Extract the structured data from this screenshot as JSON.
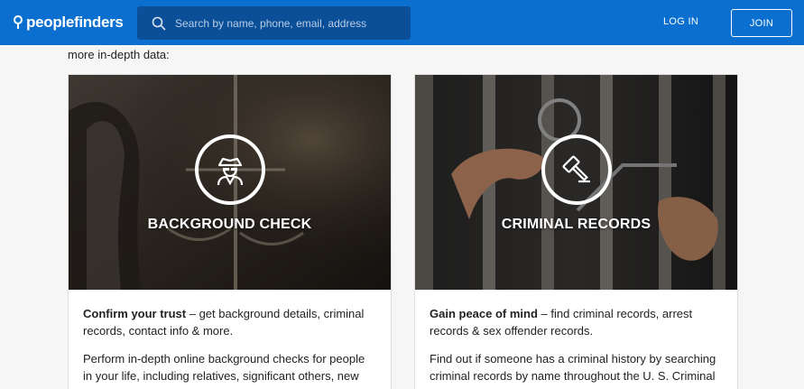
{
  "header": {
    "logo_text": "peoplefinders",
    "search_placeholder": "Search by name, phone, email, address",
    "login_label": "LOG IN",
    "join_label": "JOIN",
    "brand_color": "#0b6fd0"
  },
  "intro_text": "more in-depth data:",
  "cards": [
    {
      "title": "BACKGROUND CHECK",
      "icon": "detective-icon",
      "lead_bold": "Confirm your trust",
      "lead_rest": " – get background details, criminal records, contact info & more.",
      "body": "Perform in-depth online background checks for people in your life, including relatives, significant others, new"
    },
    {
      "title": "CRIMINAL RECORDS",
      "icon": "gavel-icon",
      "lead_bold": "Gain peace of mind",
      "lead_rest": " – find criminal records, arrest records & sex offender records.",
      "body": "Find out if someone has a criminal history by searching criminal records by name throughout the U. S. Criminal"
    }
  ]
}
